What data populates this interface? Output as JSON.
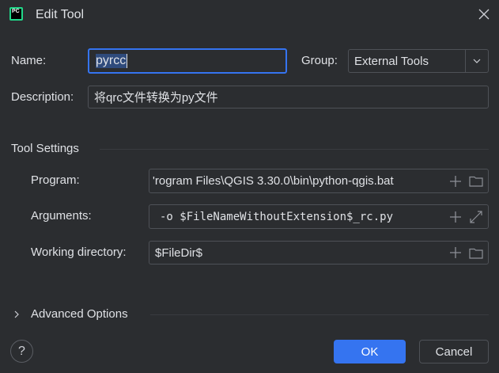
{
  "window": {
    "title": "Edit Tool",
    "app_icon": "pycharm-logo",
    "app_icon_text": "PC"
  },
  "form": {
    "name_label": "Name:",
    "name_value": "pyrcc",
    "group_label": "Group:",
    "group_value": "External Tools",
    "description_label": "Description:",
    "description_value": "将qrc文件转换为py文件"
  },
  "tool_settings": {
    "title": "Tool Settings",
    "program_label": "Program:",
    "program_value": "'rogram Files\\QGIS 3.30.0\\bin\\python-qgis.bat",
    "arguments_label": "Arguments:",
    "arguments_value": "-o $FileNameWithoutExtension$_rc.py",
    "working_dir_label": "Working directory:",
    "working_dir_value": "$FileDir$"
  },
  "advanced": {
    "label": "Advanced Options"
  },
  "footer": {
    "help": "?",
    "ok": "OK",
    "cancel": "Cancel"
  },
  "colors": {
    "accent": "#3574f0",
    "background": "#2b2d30",
    "border": "#4e5157"
  }
}
